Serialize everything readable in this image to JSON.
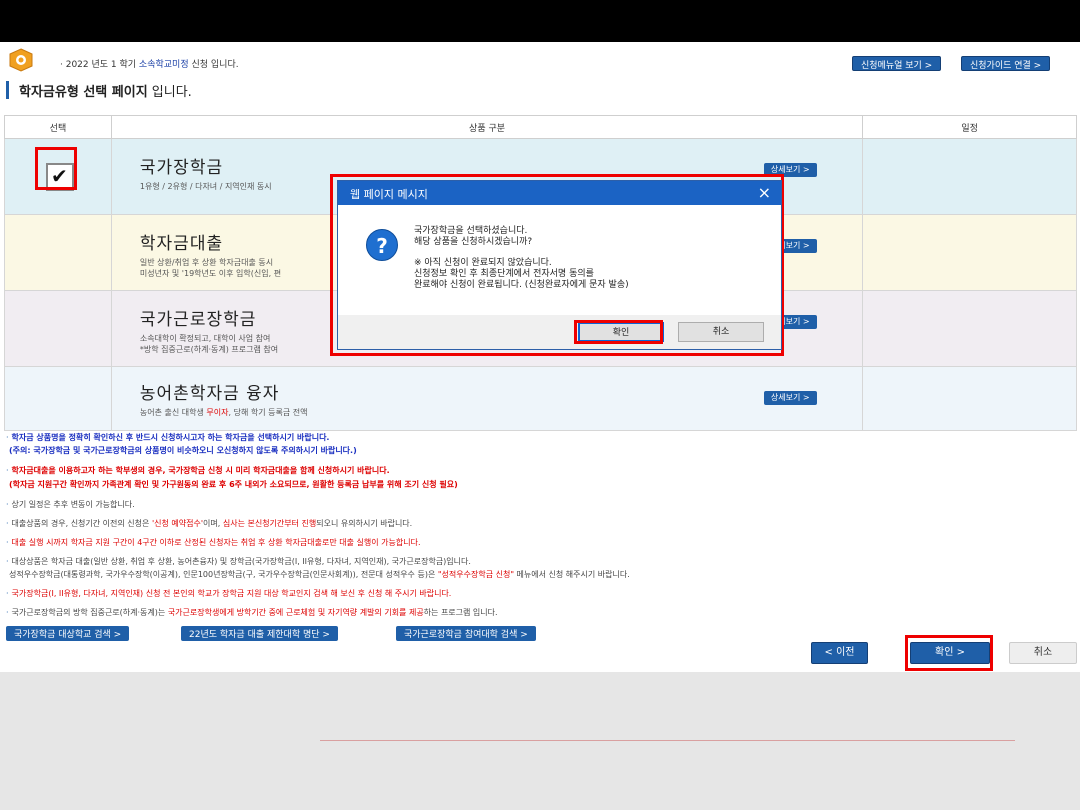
{
  "header": {
    "notice_prefix": "· 2022 년도 1 학기 ",
    "notice_school": "소속학교미정",
    "notice_suffix": " 신청 입니다.",
    "menu_all_button": "신청메뉴얼 보기  >",
    "guide_button": "신청가이드 연결  >"
  },
  "page_title": {
    "bold": "학자금유형 선택 페이지",
    "rest": " 입니다."
  },
  "table": {
    "headers": [
      "선택",
      "상품 구분",
      "일정"
    ],
    "rows": [
      {
        "name": "국가장학금",
        "desc1": "1유형 / 2유형 / 다자녀 / 지역인재 동시",
        "desc2": "",
        "checked": true,
        "detail": "상세보기  >"
      },
      {
        "name": "학자금대출",
        "desc1": "일반 상환/취업 후 상환 학자금대출 동시",
        "desc2": "미성년자 및 '19학년도 이후 입학(신입, 편",
        "detail": "상세보기  >"
      },
      {
        "name": "국가근로장학금",
        "desc1": "소속대학이 확정되고, 대학이 사업 참여",
        "desc2": "*방학 집중근로(하계·동계) 프로그램 참여",
        "detail": "상세보기  >"
      },
      {
        "name": "농어촌학자금 융자",
        "desc1_a": "농어촌 출신 대학생 ",
        "desc1_red": "무이자",
        "desc1_b": ", 당해 학기 등록금 전액",
        "detail": "상세보기  >"
      }
    ]
  },
  "dialog": {
    "title": "웹 페이지 메시지",
    "close_icon": "×",
    "icon_text": "?",
    "line1": "국가장학금을 선택하셨습니다.",
    "line2": "해당 상품을 신청하시겠습니까?",
    "line3": "※ 아직 신청이 완료되지 않았습니다.",
    "line4": "신청정보 확인 후 최종단계에서 전자서명 동의를",
    "line5": "완료해야 신청이 완료됩니다. (신청완료자에게 문자 발송)",
    "ok_label": "확인",
    "cancel_label": "취소"
  },
  "notes": {
    "n1a": "학자금 상품명을 정확히 확인하신 후 반드시 신청하시고자 하는 학자금을 선택하시기 바랍니다.",
    "n1b": "(주의: 국가장학금 및 국가근로장학금의 상품명이 비슷하오니 오신청하지 않도록 주의하시기 바랍니다.)",
    "n2a": "학자금대출을 이용하고자 하는 학부생의 경우, 국가장학금 신청 시 미리 학자금대출을 함께 신청하시기 바랍니다.",
    "n2b": "(학자금 지원구간 확인까지 가족관계 확인 및 가구원동의 완료 후 6주 내외가 소요되므로, 원활한 등록금 납부를 위해 조기 신청 필요)",
    "n3": "상기 일정은 추후 변동이 가능합니다.",
    "n4a": "대출상품의 경우, 신청기간 이전의 신청은 ",
    "n4b": "'신청 예약접수'",
    "n4c": "이며, ",
    "n4d": "심사는 본신청기간부터 진행",
    "n4e": "되오니 유의하시기 바랍니다.",
    "n5": "대출 실행 시까지 학자금 지원 구간이 4구간 이하로 산정된 신청자는 취업 후 상환 학자금대출로만 대출 실행이 가능합니다.",
    "n6a": "대상상품은 학자금 대출(일반 상환, 취업 후 상환, 농어촌융자) 및 장학금(국가장학금(I, II유형, 다자녀, 지역인재), 국가근로장학금)입니다.",
    "n6b": "성적우수장학금(대통령과학, 국가우수장학(이공계), 인문100년장학금(구, 국가우수장학금(인문사회계)), 전문대 성적우수 등)은 ",
    "n6c": "\"성적우수장학금 신청\"",
    "n6d": " 메뉴에서 신청 해주시기 바랍니다.",
    "n7": "국가장학금(I, II유형, 다자녀, 지역인재) 신청 전 본인의 학교가 장학금 지원 대상 학교인지 검색 해 보신 후 신청 해 주시기 바랍니다.",
    "n8a": "국가근로장학금의 방학 집중근로(하계·동계)는 ",
    "n8b": "국가근로장학생에게 방학기간 중에 근로체험 및 자기역량 계발의 기회를 제공",
    "n8c": "하는 프로그램 입니다."
  },
  "links": {
    "l1": "국가장학금 대상학교 검색  >",
    "l2": "22년도 학자금 대출 제한대학 명단  >",
    "l3": "국가근로장학금 참여대학 검색  >"
  },
  "nav": {
    "prev": "<    이전",
    "ok": "확인    >",
    "cancel": "취소"
  },
  "colors": {
    "accent": "#1f5fa8",
    "highlight": "#e00000",
    "dialog_title": "#1b63c4"
  }
}
